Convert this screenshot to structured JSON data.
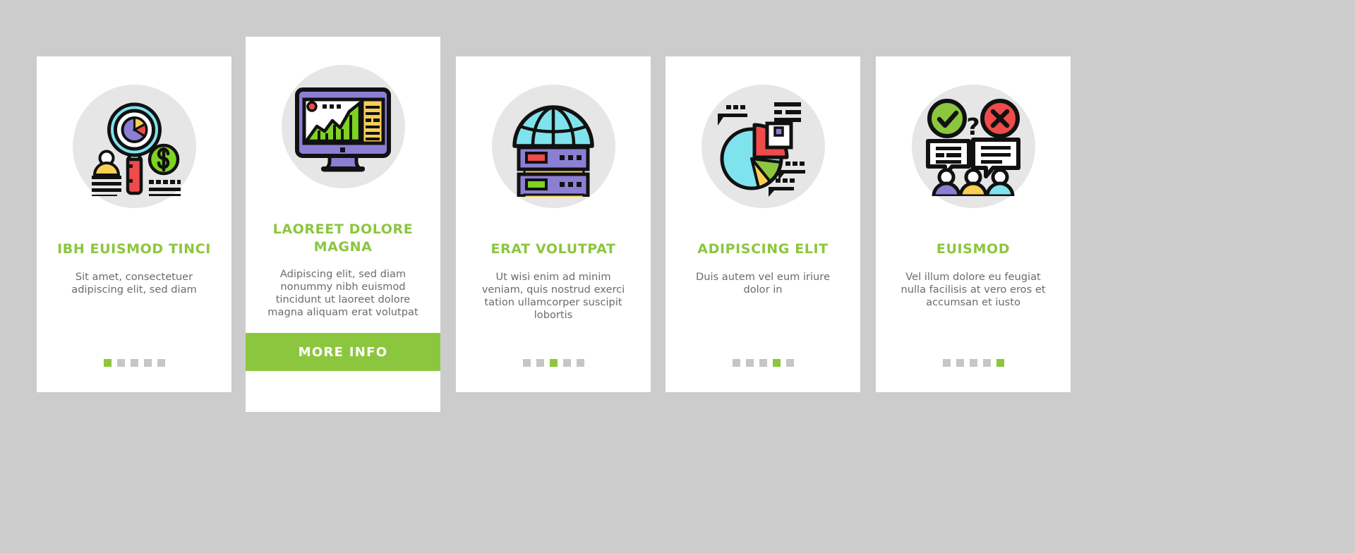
{
  "page": {
    "background_color": "#cccccc",
    "accent_color": "#8cc63e",
    "card_background": "#ffffff",
    "icon_circle_color": "#e6e6e6",
    "body_text_color": "#6b6b6b",
    "dot_inactive_color": "#c6c6c6"
  },
  "cards": [
    {
      "icon_name": "magnifier-pie-chart-analytics-icon",
      "title": "IBH EUISMOD TINCI",
      "body": "Sit amet, consectetuer adipiscing elit, sed diam",
      "dots": {
        "count": 5,
        "active_index": 0
      },
      "featured": false
    },
    {
      "icon_name": "desktop-monitor-bar-chart-icon",
      "title": "LAOREET DOLORE MAGNA",
      "body": "Adipiscing elit, sed diam nonummy nibh euismod tincidunt ut laoreet dolore magna aliquam erat volutpat",
      "button_label": "MORE INFO",
      "featured": true
    },
    {
      "icon_name": "globe-server-rack-icon",
      "title": "ERAT VOLUTPAT",
      "body": "Ut wisi enim ad minim veniam, quis nostrud exerci tation ullamcorper suscipit lobortis",
      "dots": {
        "count": 5,
        "active_index": 2
      },
      "featured": false
    },
    {
      "icon_name": "pie-chart-callouts-icon",
      "title": "ADIPISCING ELIT",
      "body": "Duis autem vel eum iriure dolor in",
      "dots": {
        "count": 5,
        "active_index": 3
      },
      "featured": false
    },
    {
      "icon_name": "survey-feedback-people-icon",
      "title": "EUISMOD",
      "body": "Vel illum dolore eu feugiat nulla facilisis at vero eros et accumsan et iusto",
      "dots": {
        "count": 5,
        "active_index": 4
      },
      "featured": false
    }
  ]
}
